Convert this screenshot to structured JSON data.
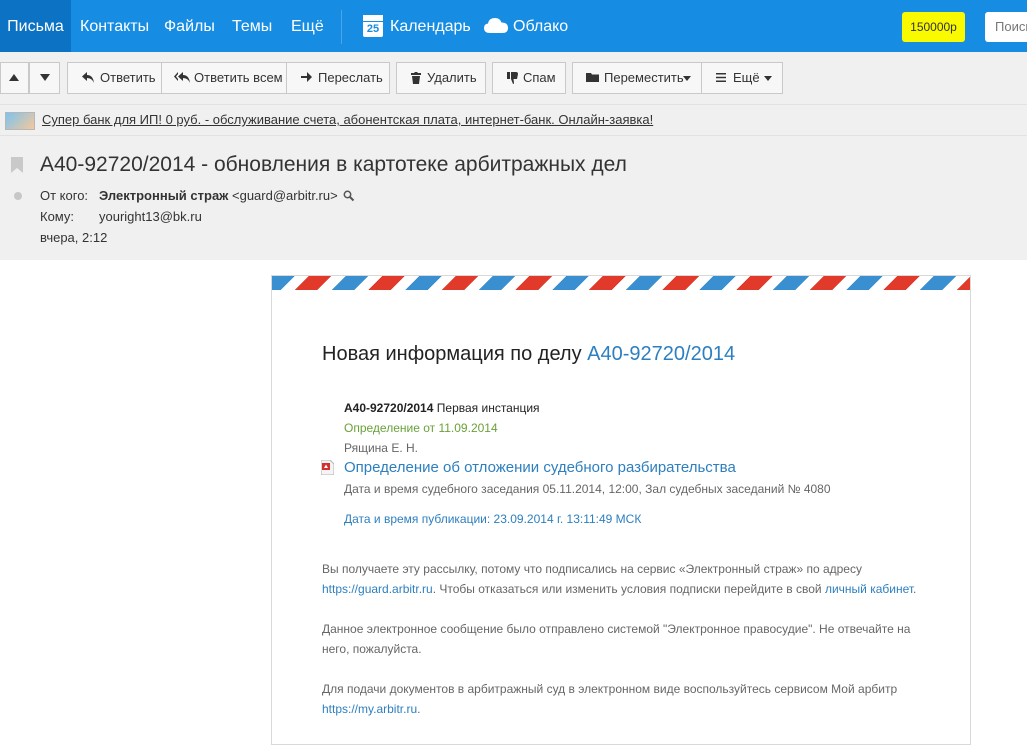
{
  "nav": {
    "items": [
      "Письма",
      "Контакты",
      "Файлы",
      "Темы",
      "Ещё"
    ],
    "calendar_day": "25",
    "calendar_label": "Календарь",
    "cloud_label": "Облако",
    "promo_label": "150000р",
    "search_placeholder": "Поиск"
  },
  "toolbar": {
    "reply": "Ответить",
    "reply_all": "Ответить всем",
    "forward": "Переслать",
    "delete": "Удалить",
    "spam": "Спам",
    "move": "Переместить",
    "more": "Ещё"
  },
  "ad": {
    "text": "Супер банк для ИП! 0 руб. - обслуживание счета, абонентская плата, интернет-банк. Онлайн-заявка!"
  },
  "message": {
    "subject": "А40-92720/2014 - обновления в картотеке арбитражных дел",
    "from_label": "От кого:",
    "from_name": "Электронный страж",
    "from_email": "<guard@arbitr.ru>",
    "to_label": "Кому:",
    "to_email": "youright13@bk.ru",
    "date": "вчера, 2:12"
  },
  "letter": {
    "title_prefix": "Новая информация по делу",
    "title_case": "А40-92720/2014",
    "case_number": "А40-92720/2014",
    "instance": "Первая инстанция",
    "decision_prefix": "Определение от",
    "decision_date": "11.09.2014",
    "judge": "Рящина Е. Н.",
    "doc_link": "Определение об отложении судебного разбирательства",
    "hearing": "Дата и время судебного заседания 05.11.2014, 12:00, Зал судебных заседаний № 4080",
    "published": "Дата и время публикации: 23.09.2014 г. 13:11:49 МСК",
    "notice1_line1": "Вы получаете эту рассылку, потому что подписались на сервис «Электронный страж» по адресу",
    "notice1_link": "https://guard.arbitr.ru",
    "notice1_line2": ". Чтобы отказаться или изменить условия подписки перейдите в свой",
    "notice1_link2": "личный кабинет",
    "notice1_end": ".",
    "notice2_line1": "Данное электронное сообщение было отправлено системой \"Электронное правосудие\". Не отвечайте на",
    "notice2_line2": "него, пожалуйста.",
    "notice3_line1": "Для подачи документов в арбитражный суд в электронном виде воспользуйтесь сервисом Мой арбитр",
    "notice3_link": "https://my.arbitr.ru",
    "notice3_end": "."
  },
  "colors": {
    "nav_bg": "#168de2",
    "nav_active": "#0c72c3",
    "promo_bg": "#f9f900",
    "link": "#2d7fbf",
    "green": "#6aa13a"
  }
}
